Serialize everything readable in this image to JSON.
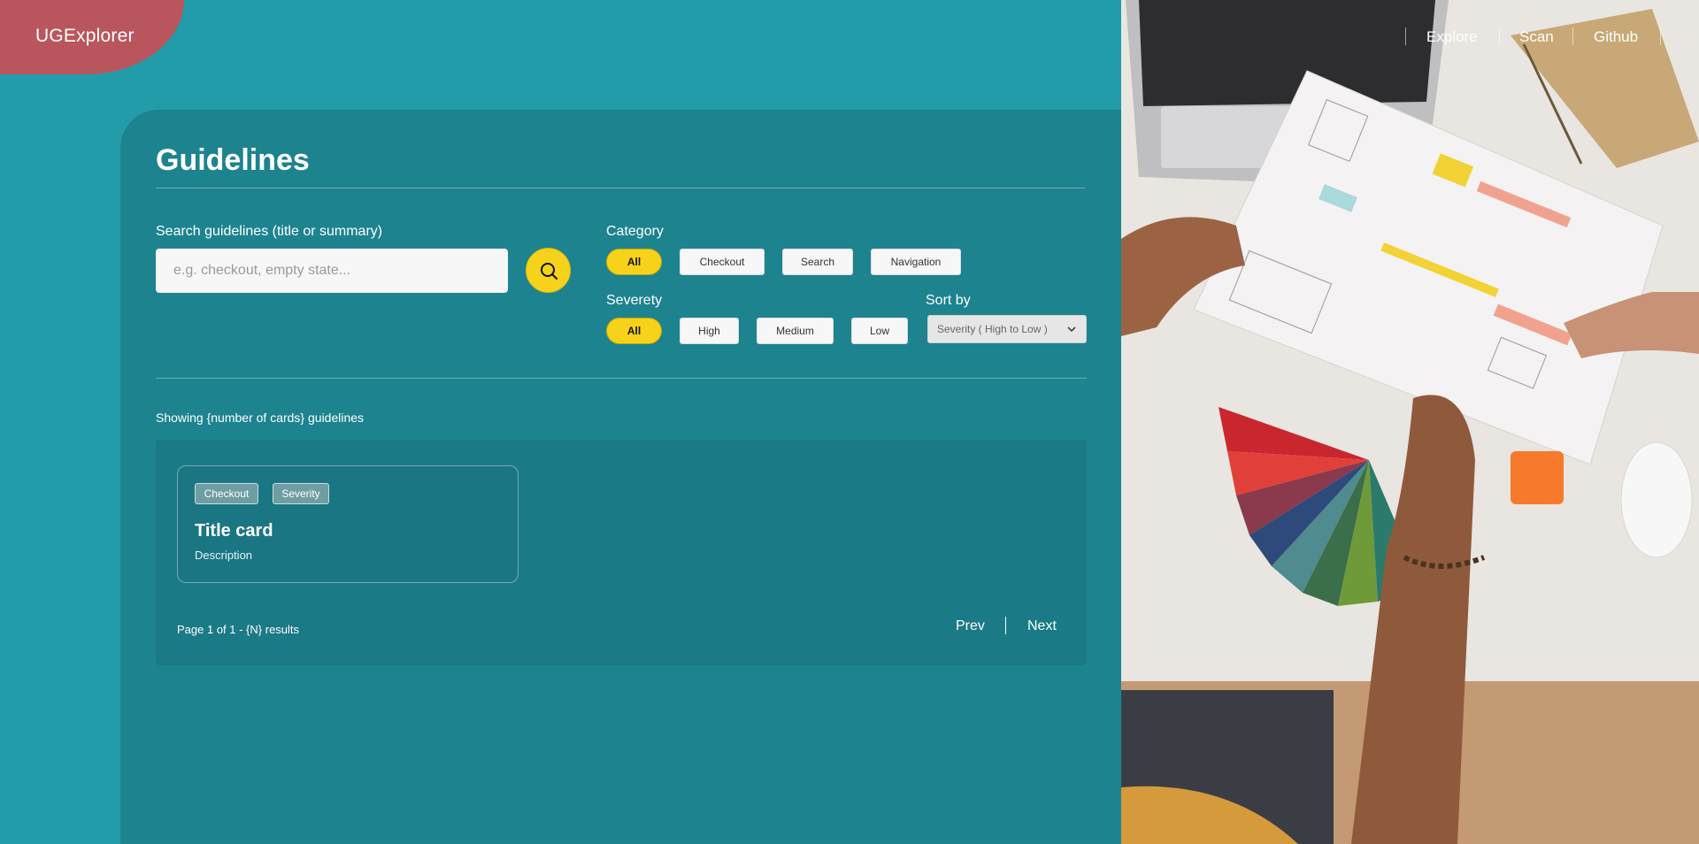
{
  "app": {
    "logo": "UGExplorer"
  },
  "nav": {
    "items": [
      {
        "label": "Explore"
      },
      {
        "label": "Scan"
      },
      {
        "label": "Github"
      }
    ]
  },
  "page": {
    "title": "Guidelines"
  },
  "search": {
    "label": "Search guidelines (title or summary)",
    "placeholder": "e.g. checkout, empty state...",
    "value": "",
    "button_icon": "search-icon"
  },
  "filters": {
    "category": {
      "label": "Category",
      "options": [
        "All",
        "Checkout",
        "Search",
        "Navigation"
      ],
      "selected": "All"
    },
    "severity": {
      "label": "Severety",
      "options": [
        "All",
        "High",
        "Medium",
        "Low"
      ],
      "selected": "All"
    },
    "sort": {
      "label": "Sort by",
      "value": "Severity ( High to Low )",
      "icon": "chevron-down-icon"
    }
  },
  "results": {
    "count_text": "Showing {number of cards} guidelines",
    "cards": [
      {
        "tags": [
          "Checkout",
          "Severity"
        ],
        "title": "Title card",
        "description": "Description"
      }
    ],
    "page_info": "Page 1 of 1 - {N} results",
    "prev_label": "Prev",
    "next_label": "Next"
  },
  "colors": {
    "background": "#229ca8",
    "panel": "#1d838f",
    "results_box": "#1a7a86",
    "accent": "#f6d21a",
    "logo_blob": "#b9565d"
  }
}
